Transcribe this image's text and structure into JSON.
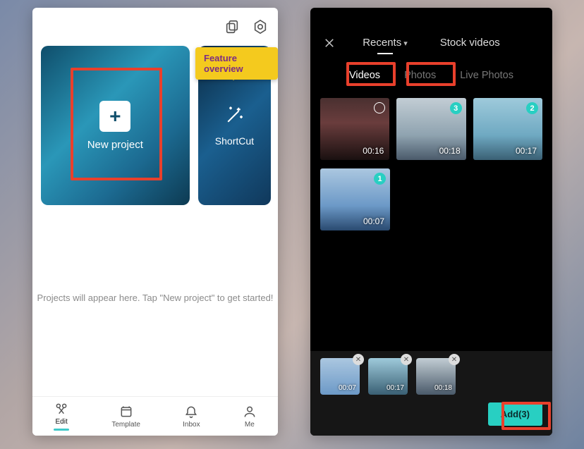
{
  "left": {
    "hero": {
      "new_project": "New project",
      "shortcut": "ShortCut"
    },
    "feature_overview": "Feature overview",
    "empty": "Projects will appear here. Tap \"New project\" to get started!",
    "nav": {
      "edit": "Edit",
      "template": "Template",
      "inbox": "Inbox",
      "me": "Me"
    }
  },
  "right": {
    "top_tabs": {
      "recents": "Recents",
      "stock": "Stock videos"
    },
    "cats": {
      "videos": "Videos",
      "photos": "Photos",
      "live": "Live Photos"
    },
    "grid": [
      {
        "dur": "00:16",
        "selected": false
      },
      {
        "dur": "00:18",
        "selected": true,
        "num": 3
      },
      {
        "dur": "00:17",
        "selected": true,
        "num": 2
      },
      {
        "dur": "00:07",
        "selected": true,
        "num": 1
      }
    ],
    "tray": [
      {
        "dur": "00:07"
      },
      {
        "dur": "00:17"
      },
      {
        "dur": "00:18"
      }
    ],
    "add_label": "Add(3)"
  }
}
